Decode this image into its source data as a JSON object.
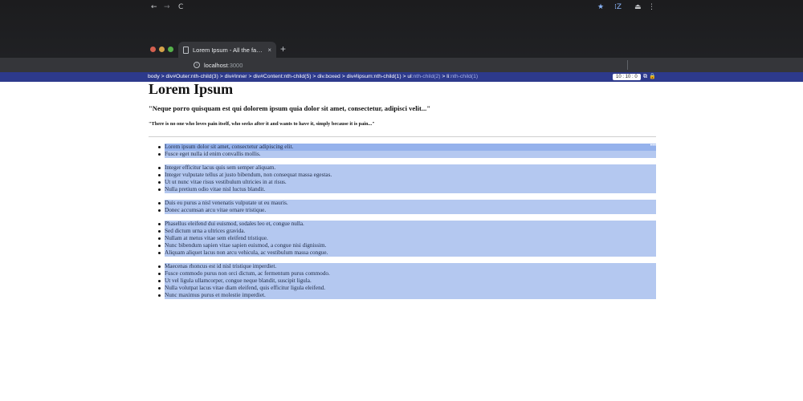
{
  "browser": {
    "tab_title": "Lorem Ipsum - All the facts - Li",
    "tab_close": "×",
    "new_tab": "+",
    "url_host": "localhost",
    "url_port": ":3000",
    "icons": {
      "back": "←",
      "forward": "→",
      "reload": "C",
      "star": "★",
      "extension": "⁞Z",
      "profile": "⏏",
      "menu": "⋮",
      "info": "i"
    }
  },
  "inspector": {
    "breadcrumb": [
      {
        "text": "body",
        "dim": ""
      },
      {
        "text": "div#Outer:nth-child(3)",
        "dim": ""
      },
      {
        "text": "div#Inner",
        "dim": ""
      },
      {
        "text": "div#Content:nth-child(5)",
        "dim": ""
      },
      {
        "text": "div.boxed",
        "dim": ""
      },
      {
        "text": "div#lipsum:nth-child(1)",
        "dim": ""
      },
      {
        "text": "ul",
        "dim": ":nth-child(2)"
      },
      {
        "text": "li",
        "dim": ":nth-child(1)"
      }
    ],
    "dimensions": "10 : 10 : 0",
    "icons": "⧉ 🔒"
  },
  "page": {
    "heading": "Lorem Ipsum",
    "quote": "\"Neque porro quisquam est qui dolorem ipsum quia dolor sit amet, consectetur, adipisci velit...\"",
    "translation": "\"There is no one who loves pain itself, who seeks after it and wants to have it, simply because it is pain...\"",
    "more_icon": "•••",
    "paragraphs": [
      [
        "Lorem ipsum dolor sit amet, consectetur adipiscing elit.",
        "Fusce eget nulla id enim convallis mollis."
      ],
      [
        "Integer efficitur lacus quis sem semper aliquam.",
        "Integer vulputate tellus at justo bibendum, non consequat massa egestas.",
        "Ut ut nunc vitae risus vestibulum ultricies in at risus.",
        "Nulla pretium odio vitae nisl luctus blandit."
      ],
      [
        "Duis eu purus a nisl venenatis vulputate ut eu mauris.",
        "Donec accumsan arcu vitae ornare tristique."
      ],
      [
        "Phasellus eleifend dui euismod, sodales leo et, congue nulla.",
        "Sed dictum urna a ultrices gravida.",
        "Nullam at metus vitae sem eleifend tristique.",
        "Nunc bibendum sapien vitae sapien euismod, a congue nisi dignissim.",
        "Aliquam aliquet lacus non arcu vehicula, ac vestibulum massa congue."
      ],
      [
        "Maecenas rhoncus est id nisl tristique imperdiet.",
        "Fusce commodo purus non orci dictum, ac fermentum purus commodo.",
        "Ut vel ligula ullamcorper, congue neque blandit, suscipit ligula.",
        "Nulla volutpat lacus vitae diam eleifend, quis efficitur ligula eleifend.",
        "Nunc maximus purus et molestie imperdiet."
      ]
    ]
  },
  "colors": {
    "highlight": "#b4c8f0",
    "selected": "#95b2ec",
    "inspector_bar": "#2d3a8c"
  }
}
